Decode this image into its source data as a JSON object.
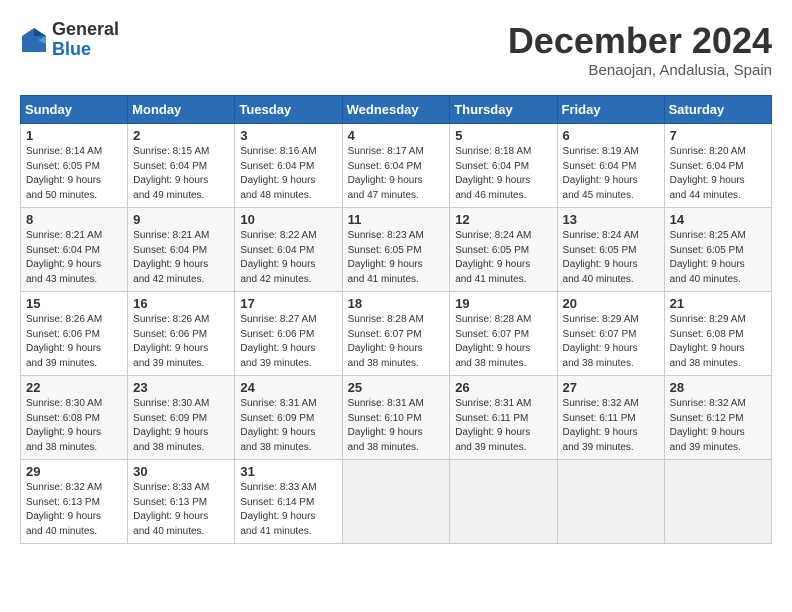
{
  "header": {
    "logo_general": "General",
    "logo_blue": "Blue",
    "month_title": "December 2024",
    "location": "Benaojan, Andalusia, Spain"
  },
  "calendar": {
    "headers": [
      "Sunday",
      "Monday",
      "Tuesday",
      "Wednesday",
      "Thursday",
      "Friday",
      "Saturday"
    ],
    "rows": [
      [
        {
          "day": "1",
          "text": "Sunrise: 8:14 AM\nSunset: 6:05 PM\nDaylight: 9 hours\nand 50 minutes."
        },
        {
          "day": "2",
          "text": "Sunrise: 8:15 AM\nSunset: 6:04 PM\nDaylight: 9 hours\nand 49 minutes."
        },
        {
          "day": "3",
          "text": "Sunrise: 8:16 AM\nSunset: 6:04 PM\nDaylight: 9 hours\nand 48 minutes."
        },
        {
          "day": "4",
          "text": "Sunrise: 8:17 AM\nSunset: 6:04 PM\nDaylight: 9 hours\nand 47 minutes."
        },
        {
          "day": "5",
          "text": "Sunrise: 8:18 AM\nSunset: 6:04 PM\nDaylight: 9 hours\nand 46 minutes."
        },
        {
          "day": "6",
          "text": "Sunrise: 8:19 AM\nSunset: 6:04 PM\nDaylight: 9 hours\nand 45 minutes."
        },
        {
          "day": "7",
          "text": "Sunrise: 8:20 AM\nSunset: 6:04 PM\nDaylight: 9 hours\nand 44 minutes."
        }
      ],
      [
        {
          "day": "8",
          "text": "Sunrise: 8:21 AM\nSunset: 6:04 PM\nDaylight: 9 hours\nand 43 minutes."
        },
        {
          "day": "9",
          "text": "Sunrise: 8:21 AM\nSunset: 6:04 PM\nDaylight: 9 hours\nand 42 minutes."
        },
        {
          "day": "10",
          "text": "Sunrise: 8:22 AM\nSunset: 6:04 PM\nDaylight: 9 hours\nand 42 minutes."
        },
        {
          "day": "11",
          "text": "Sunrise: 8:23 AM\nSunset: 6:05 PM\nDaylight: 9 hours\nand 41 minutes."
        },
        {
          "day": "12",
          "text": "Sunrise: 8:24 AM\nSunset: 6:05 PM\nDaylight: 9 hours\nand 41 minutes."
        },
        {
          "day": "13",
          "text": "Sunrise: 8:24 AM\nSunset: 6:05 PM\nDaylight: 9 hours\nand 40 minutes."
        },
        {
          "day": "14",
          "text": "Sunrise: 8:25 AM\nSunset: 6:05 PM\nDaylight: 9 hours\nand 40 minutes."
        }
      ],
      [
        {
          "day": "15",
          "text": "Sunrise: 8:26 AM\nSunset: 6:06 PM\nDaylight: 9 hours\nand 39 minutes."
        },
        {
          "day": "16",
          "text": "Sunrise: 8:26 AM\nSunset: 6:06 PM\nDaylight: 9 hours\nand 39 minutes."
        },
        {
          "day": "17",
          "text": "Sunrise: 8:27 AM\nSunset: 6:06 PM\nDaylight: 9 hours\nand 39 minutes."
        },
        {
          "day": "18",
          "text": "Sunrise: 8:28 AM\nSunset: 6:07 PM\nDaylight: 9 hours\nand 38 minutes."
        },
        {
          "day": "19",
          "text": "Sunrise: 8:28 AM\nSunset: 6:07 PM\nDaylight: 9 hours\nand 38 minutes."
        },
        {
          "day": "20",
          "text": "Sunrise: 8:29 AM\nSunset: 6:07 PM\nDaylight: 9 hours\nand 38 minutes."
        },
        {
          "day": "21",
          "text": "Sunrise: 8:29 AM\nSunset: 6:08 PM\nDaylight: 9 hours\nand 38 minutes."
        }
      ],
      [
        {
          "day": "22",
          "text": "Sunrise: 8:30 AM\nSunset: 6:08 PM\nDaylight: 9 hours\nand 38 minutes."
        },
        {
          "day": "23",
          "text": "Sunrise: 8:30 AM\nSunset: 6:09 PM\nDaylight: 9 hours\nand 38 minutes."
        },
        {
          "day": "24",
          "text": "Sunrise: 8:31 AM\nSunset: 6:09 PM\nDaylight: 9 hours\nand 38 minutes."
        },
        {
          "day": "25",
          "text": "Sunrise: 8:31 AM\nSunset: 6:10 PM\nDaylight: 9 hours\nand 38 minutes."
        },
        {
          "day": "26",
          "text": "Sunrise: 8:31 AM\nSunset: 6:11 PM\nDaylight: 9 hours\nand 39 minutes."
        },
        {
          "day": "27",
          "text": "Sunrise: 8:32 AM\nSunset: 6:11 PM\nDaylight: 9 hours\nand 39 minutes."
        },
        {
          "day": "28",
          "text": "Sunrise: 8:32 AM\nSunset: 6:12 PM\nDaylight: 9 hours\nand 39 minutes."
        }
      ],
      [
        {
          "day": "29",
          "text": "Sunrise: 8:32 AM\nSunset: 6:13 PM\nDaylight: 9 hours\nand 40 minutes."
        },
        {
          "day": "30",
          "text": "Sunrise: 8:33 AM\nSunset: 6:13 PM\nDaylight: 9 hours\nand 40 minutes."
        },
        {
          "day": "31",
          "text": "Sunrise: 8:33 AM\nSunset: 6:14 PM\nDaylight: 9 hours\nand 41 minutes."
        },
        {
          "day": "",
          "text": ""
        },
        {
          "day": "",
          "text": ""
        },
        {
          "day": "",
          "text": ""
        },
        {
          "day": "",
          "text": ""
        }
      ]
    ]
  }
}
